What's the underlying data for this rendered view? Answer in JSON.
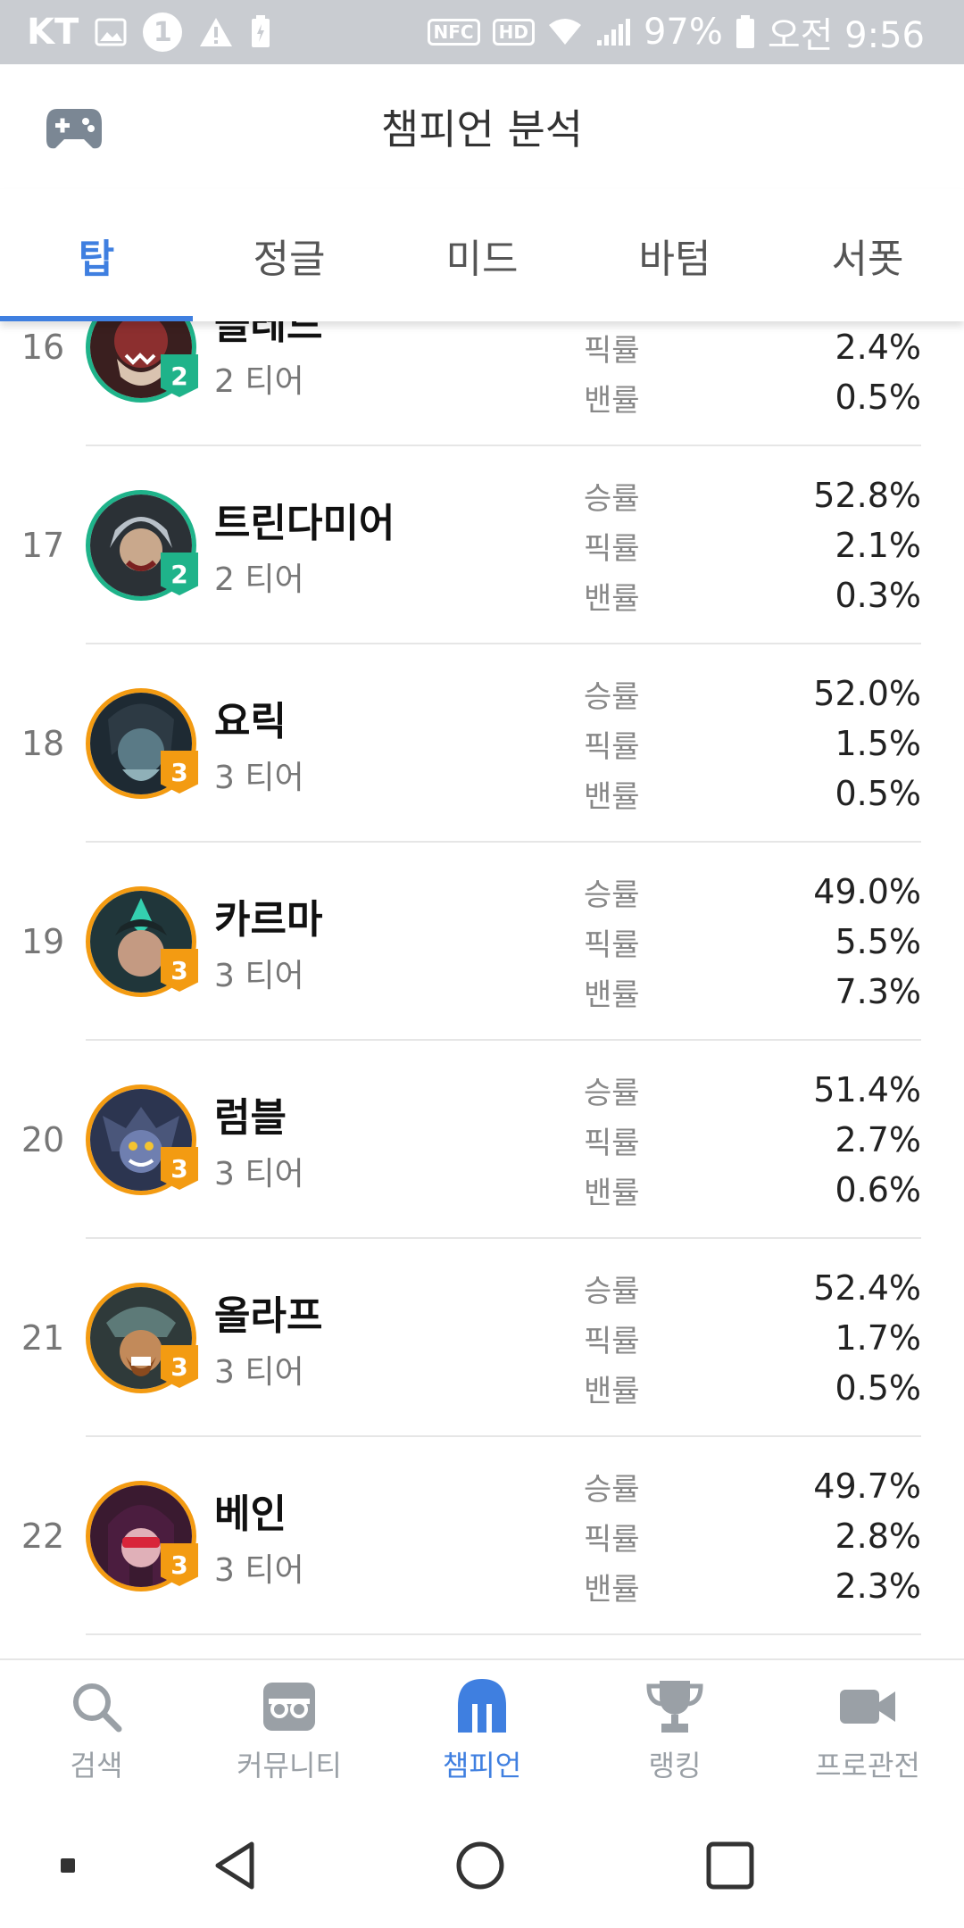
{
  "status_bar": {
    "carrier": "KT",
    "battery": "97%",
    "time": "오전 9:56"
  },
  "app_bar": {
    "title": "챔피언 분석"
  },
  "tabs": [
    {
      "label": "탑"
    },
    {
      "label": "정글"
    },
    {
      "label": "미드"
    },
    {
      "label": "바텀"
    },
    {
      "label": "서폿"
    }
  ],
  "stat_labels": {
    "win": "승률",
    "pick": "픽률",
    "ban": "밴률"
  },
  "champions": [
    {
      "rank": "16",
      "name": "클레드",
      "tier": "2",
      "tier_text": "2 티어",
      "win": "",
      "pick": "2.4%",
      "ban": "0.5%"
    },
    {
      "rank": "17",
      "name": "트린다미어",
      "tier": "2",
      "tier_text": "2 티어",
      "win": "52.8%",
      "pick": "2.1%",
      "ban": "0.3%"
    },
    {
      "rank": "18",
      "name": "요릭",
      "tier": "3",
      "tier_text": "3 티어",
      "win": "52.0%",
      "pick": "1.5%",
      "ban": "0.5%"
    },
    {
      "rank": "19",
      "name": "카르마",
      "tier": "3",
      "tier_text": "3 티어",
      "win": "49.0%",
      "pick": "5.5%",
      "ban": "7.3%"
    },
    {
      "rank": "20",
      "name": "럼블",
      "tier": "3",
      "tier_text": "3 티어",
      "win": "51.4%",
      "pick": "2.7%",
      "ban": "0.6%"
    },
    {
      "rank": "21",
      "name": "올라프",
      "tier": "3",
      "tier_text": "3 티어",
      "win": "52.4%",
      "pick": "1.7%",
      "ban": "0.5%"
    },
    {
      "rank": "22",
      "name": "베인",
      "tier": "3",
      "tier_text": "3 티어",
      "win": "49.7%",
      "pick": "2.8%",
      "ban": "2.3%"
    }
  ],
  "bottom_nav": [
    {
      "label": "검색",
      "icon": "search-icon"
    },
    {
      "label": "커뮤니티",
      "icon": "community-icon"
    },
    {
      "label": "챔피언",
      "icon": "champion-helmet-icon"
    },
    {
      "label": "랭킹",
      "icon": "trophy-icon"
    },
    {
      "label": "프로관전",
      "icon": "video-camera-icon"
    }
  ],
  "colors": {
    "accent": "#3f7fe0",
    "tier2": "#1fb38a",
    "tier3": "#f39b12",
    "status_bar": "#c9ccd1"
  }
}
